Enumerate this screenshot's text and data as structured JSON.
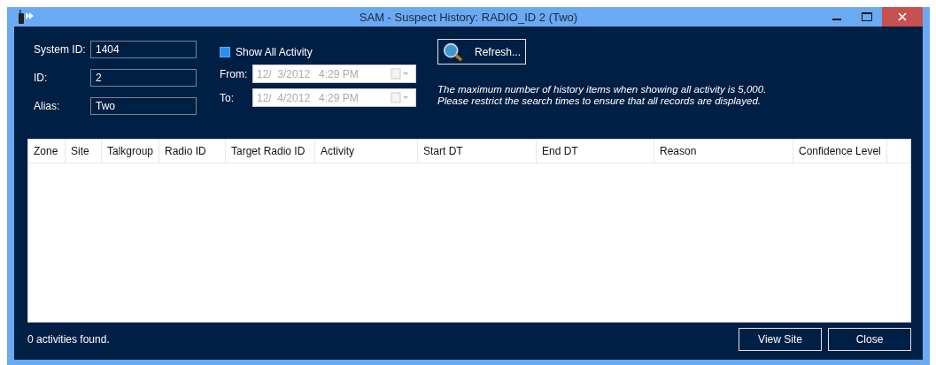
{
  "window": {
    "title": "SAM - Suspect History: RADIO_ID 2 (Two)"
  },
  "fields": [
    {
      "label": "System ID:",
      "value": "1404"
    },
    {
      "label": "ID:",
      "value": "2"
    },
    {
      "label": "Alias:",
      "value": "Two"
    }
  ],
  "show_all_activity": {
    "label": "Show All Activity",
    "checked": true
  },
  "dates": [
    {
      "label": "From:",
      "value": "12/  3/2012   4:29 PM",
      "disabled": true
    },
    {
      "label": "To:",
      "value": "12/  4/2012   4:29 PM",
      "disabled": true
    }
  ],
  "refresh_button": "Refresh...",
  "note": [
    "The maximum number of history items when showing all activity is 5,000.",
    "Please restrict the search times to ensure that all records are displayed."
  ],
  "table": {
    "columns": [
      "Zone",
      "Site",
      "Talkgroup",
      "Radio ID",
      "Target Radio ID",
      "Activity",
      "Start DT",
      "End DT",
      "Reason",
      "Confidence Level"
    ]
  },
  "status": "0 activities found.",
  "buttons": [
    "View Site",
    "Close"
  ]
}
